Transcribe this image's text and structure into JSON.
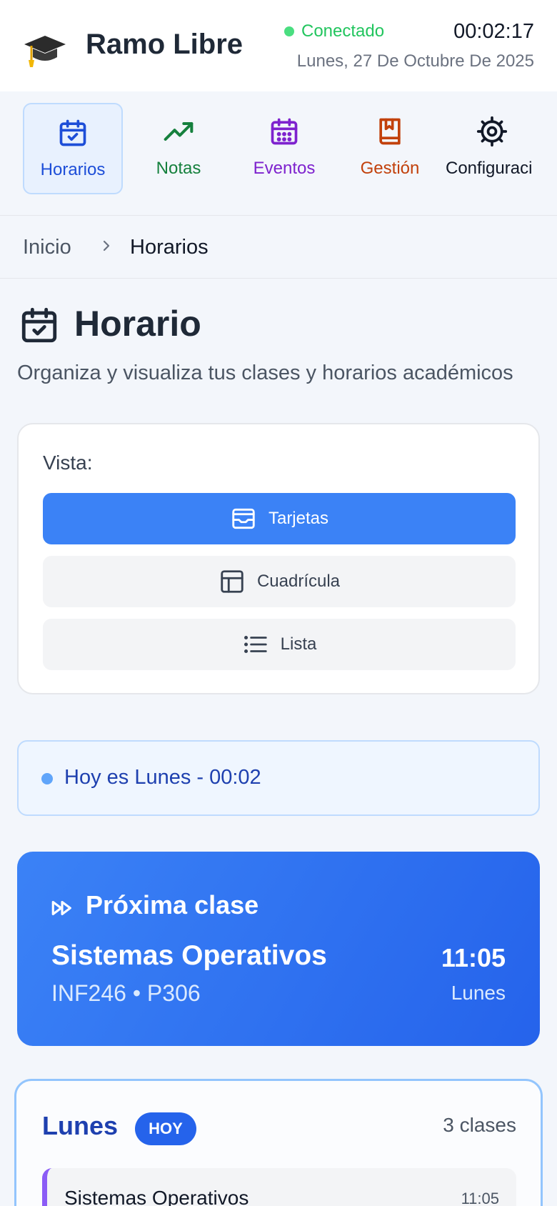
{
  "header": {
    "app_title": "Ramo Libre",
    "status": "Conectado",
    "clock": "00:02:17",
    "date": "Lunes, 27 De Octubre De 2025"
  },
  "tabs": [
    {
      "label": "Horarios",
      "icon": "calendar-check-icon",
      "color": "#1d4ed8",
      "active": true
    },
    {
      "label": "Notas",
      "icon": "trending-up-icon",
      "color": "#15803d",
      "active": false
    },
    {
      "label": "Eventos",
      "icon": "calendar-grid-icon",
      "color": "#7e22ce",
      "active": false
    },
    {
      "label": "Gestión",
      "icon": "bookmark-book-icon",
      "color": "#c2410c",
      "active": false
    },
    {
      "label": "Configuraci",
      "icon": "gear-icon",
      "color": "#111827",
      "active": false
    }
  ],
  "breadcrumb": {
    "home": "Inicio",
    "current": "Horarios"
  },
  "page": {
    "title": "Horario",
    "subtitle": "Organiza y visualiza tus clases y horarios académicos"
  },
  "view": {
    "label": "Vista:",
    "options": [
      {
        "label": "Tarjetas",
        "icon": "inbox-icon",
        "selected": true
      },
      {
        "label": "Cuadrícula",
        "icon": "table-icon",
        "selected": false
      },
      {
        "label": "Lista",
        "icon": "list-icon",
        "selected": false
      }
    ]
  },
  "today": {
    "text": "Hoy es Lunes - 00:02"
  },
  "next_class": {
    "label": "Próxima clase",
    "subject": "Sistemas Operativos",
    "meta": "INF246 • P306",
    "time": "11:05",
    "day": "Lunes"
  },
  "day_card": {
    "day": "Lunes",
    "badge": "HOY",
    "count": "3 clases",
    "first_class": {
      "name": "Sistemas Operativos",
      "time": "11:05",
      "accent": "#8b5cf6"
    }
  },
  "colors": {
    "primary": "#3b82f6",
    "primary_dark": "#2563eb",
    "success": "#22c55e"
  }
}
